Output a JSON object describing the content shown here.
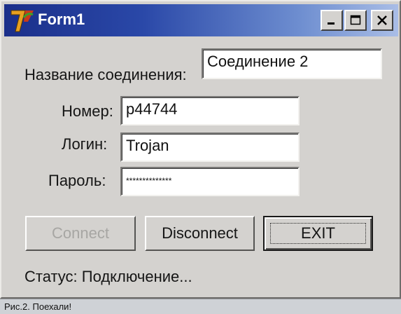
{
  "window": {
    "title": "Form1",
    "controls": {
      "minimize": "minimize",
      "maximize": "maximize",
      "close": "close"
    }
  },
  "form": {
    "connection_name_label": "Название соединения:",
    "connection_name_value": "Соединение 2",
    "number_label": "Номер:",
    "number_value": "p44744",
    "login_label": "Логин:",
    "login_value": "Trojan",
    "password_label": "Пароль:",
    "password_value": "**************"
  },
  "buttons": {
    "connect": "Connect",
    "disconnect": "Disconnect",
    "exit": "EXIT"
  },
  "status": {
    "text": "Статус: Подключение..."
  },
  "caption": {
    "text": "Рис.2. Поехали!"
  },
  "colors": {
    "title_gradient_start": "#1b2f8a",
    "title_gradient_end": "#a9bde6",
    "face": "#d4d2cf",
    "disabled_text": "#a7a6a3"
  }
}
